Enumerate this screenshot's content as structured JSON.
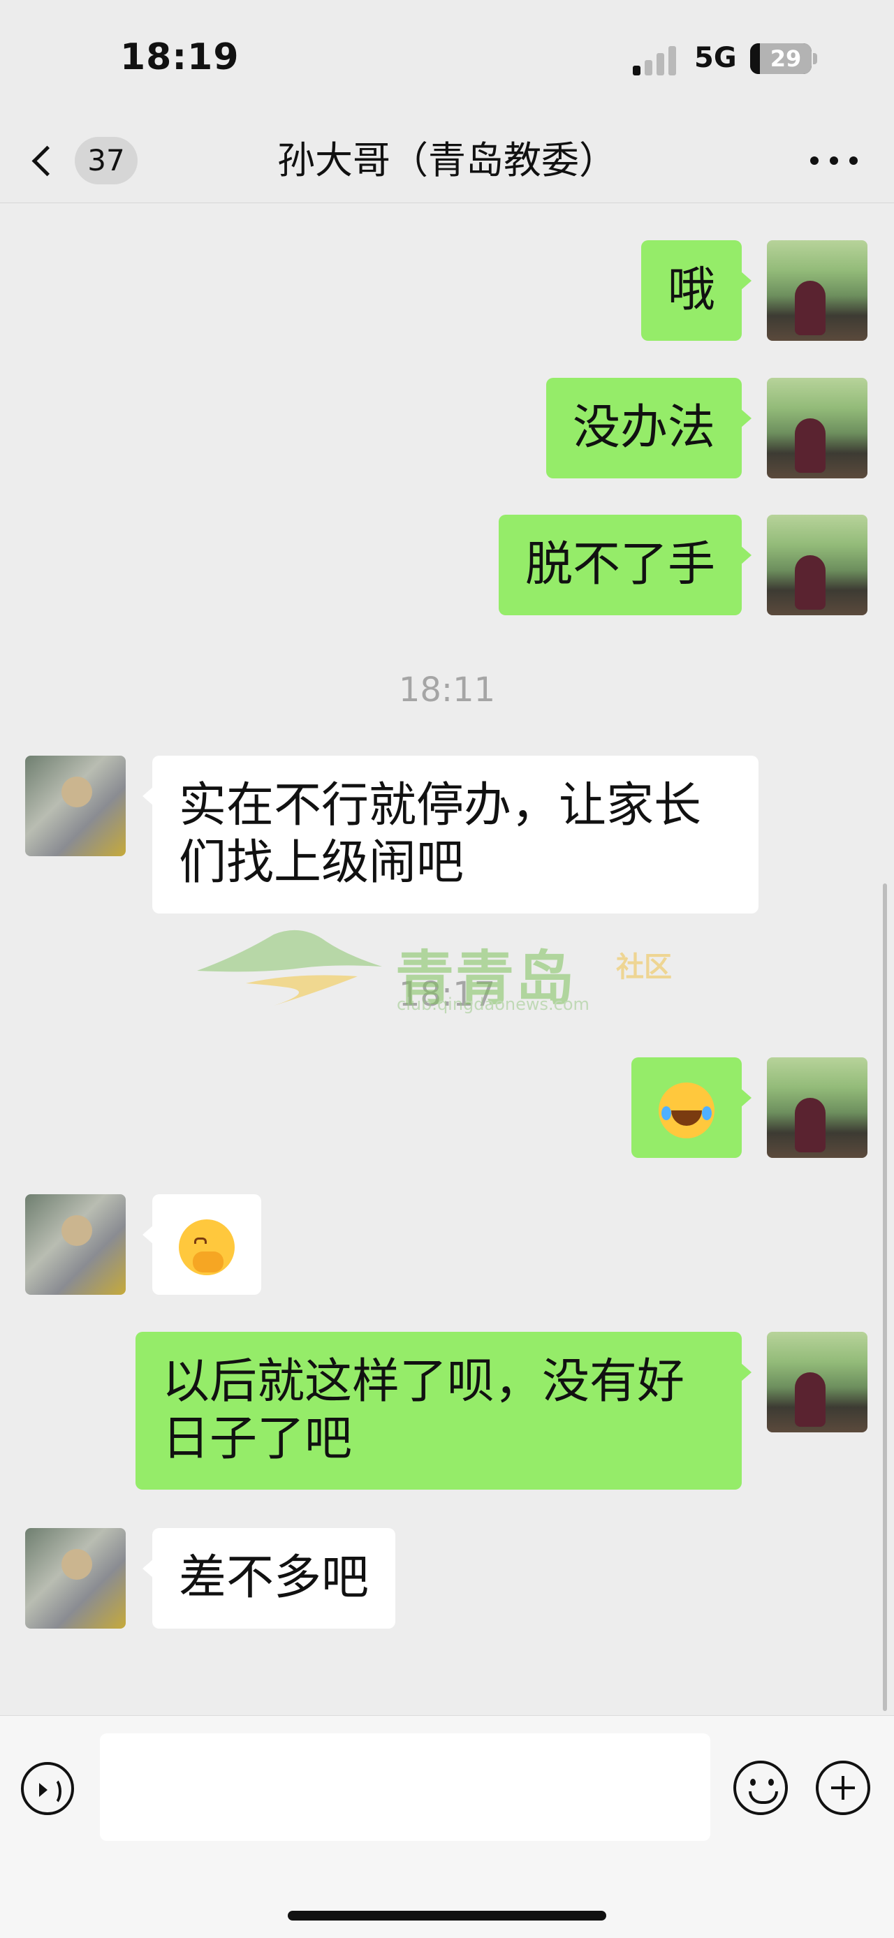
{
  "status_bar": {
    "time": "18:19",
    "network": "5G",
    "battery": "29"
  },
  "nav": {
    "unread_count": "37",
    "title": "孙大哥（青岛教委）"
  },
  "messages": [
    {
      "side": "right",
      "text": "哦"
    },
    {
      "side": "right",
      "text": "没办法"
    },
    {
      "side": "right",
      "text": "脱不了手"
    },
    {
      "timestamp": "18:11"
    },
    {
      "side": "left",
      "text": "实在不行就停办，让家长们找上级闹吧"
    },
    {
      "timestamp": "18:17"
    },
    {
      "side": "right",
      "emoji": "face-with-tears-of-joy-icon"
    },
    {
      "side": "left",
      "emoji": "face-with-hand-over-mouth-icon"
    },
    {
      "side": "right",
      "text": "以后就这样了呗，没有好日子了吧"
    },
    {
      "side": "left",
      "text": "差不多吧"
    }
  ],
  "watermark": {
    "title": "青青岛",
    "subtitle": "社区",
    "url": "club.qingdaonews.com"
  },
  "input": {
    "placeholder": ""
  },
  "colors": {
    "background": "#ededed",
    "self_bubble": "#95ec69",
    "other_bubble": "#ffffff",
    "timestamp": "#a5a5a5"
  }
}
